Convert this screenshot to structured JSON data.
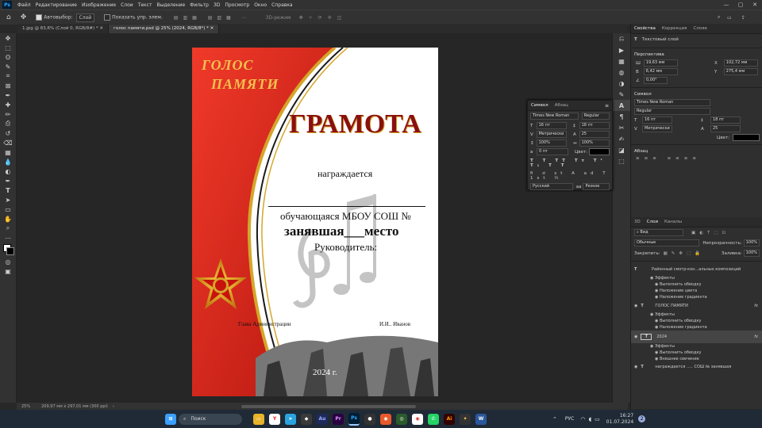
{
  "menu": {
    "app_icon": "Ps",
    "items": [
      "Файл",
      "Редактирование",
      "Изображение",
      "Слои",
      "Текст",
      "Выделение",
      "Фильтр",
      "3D",
      "Просмотр",
      "Окно",
      "Справка"
    ]
  },
  "options_bar": {
    "autoselect_label": "Автовыбор:",
    "autoselect_value": "Слой",
    "show_transform_label": "Показать упр. элем.",
    "mode_3d": "3D-режим"
  },
  "doc_tabs": [
    {
      "label": "1.jpg @ 83,6% (Слой 0, RGB/8#) *"
    },
    {
      "label": "голос памяти.psd @ 25% (2024, RGB/8*) *"
    }
  ],
  "document": {
    "brand_line1": "ГОЛОС",
    "brand_line2": "ПАМЯТИ",
    "title": "ГРАМОТА",
    "awarded": "награждается",
    "student": "обучающаяся МБОУ СОШ №",
    "place": "занявшая___место",
    "leader": "Руководитель:",
    "sign_left": "Глава Администрации",
    "sign_right": "И.И.. Иванов",
    "year": "2024 г."
  },
  "status": {
    "zoom": "25%",
    "size": "209,97 мм x 297,01 мм (300 ppi)"
  },
  "char_panel": {
    "tabs": [
      "Символ",
      "Абзац"
    ],
    "font": "Times New Roman",
    "style": "Regular",
    "size": "16 пт",
    "leading": "18 пт",
    "kerning": "Метрически",
    "tracking": "25",
    "vscale": "100%",
    "hscale": "100%",
    "baseline": "0 пт",
    "color_label": "Цвет:",
    "language": "Русский",
    "aa": "Резкое"
  },
  "right_panel": {
    "tabs": [
      "Свойства",
      "Коррекция",
      "Library"
    ],
    "tab3_label": "Слояе",
    "layer_type": "Текстовый слой",
    "transform_title": "Перспектива",
    "W": "19,63 мм",
    "H": "6,42 мм",
    "X": "102,72 мм",
    "Y": "275,4 мм",
    "angle": "0,00°",
    "char_title": "Символ",
    "font": "Times New Roman",
    "style": "Regular",
    "size": "16 пт",
    "leading": "18 пт",
    "kerning": "Метрически",
    "tracking": "25",
    "color_label": "Цвет:",
    "para_title": "Абзац"
  },
  "layers_panel": {
    "tabs": [
      "3D",
      "Слои",
      "Каналы"
    ],
    "kind": "Вид",
    "blend": "Обычные",
    "opacity_label": "Непрозрачность:",
    "opacity": "100%",
    "lock_label": "Закрепить:",
    "fill_label": "Заливка:",
    "fill": "100%",
    "layers": [
      {
        "name": "Районный смотр-кон...альных композиций",
        "effects": [
          "Эффекты",
          "Выполнить обводку",
          "Наложение цвета",
          "Наложение градиента"
        ]
      },
      {
        "name": "ГОЛОС ПАМЯТИ",
        "effects": [
          "Эффекты",
          "Выполнить обводку",
          "Наложение градиента"
        ]
      },
      {
        "name": "2024",
        "effects": [
          "Эффекты",
          "Выполнить обводку",
          "Внешнее свечение"
        ]
      },
      {
        "name": "награждается ..... СОШ № занявшая"
      }
    ]
  },
  "taskbar": {
    "search": "Поиск",
    "lang": "РУС",
    "time": "16:27",
    "date": "01.07.2024",
    "badge": "2"
  },
  "colors": {
    "accent": "#31a8ff",
    "red": "#d8261e",
    "gold": "#d4a62a"
  }
}
